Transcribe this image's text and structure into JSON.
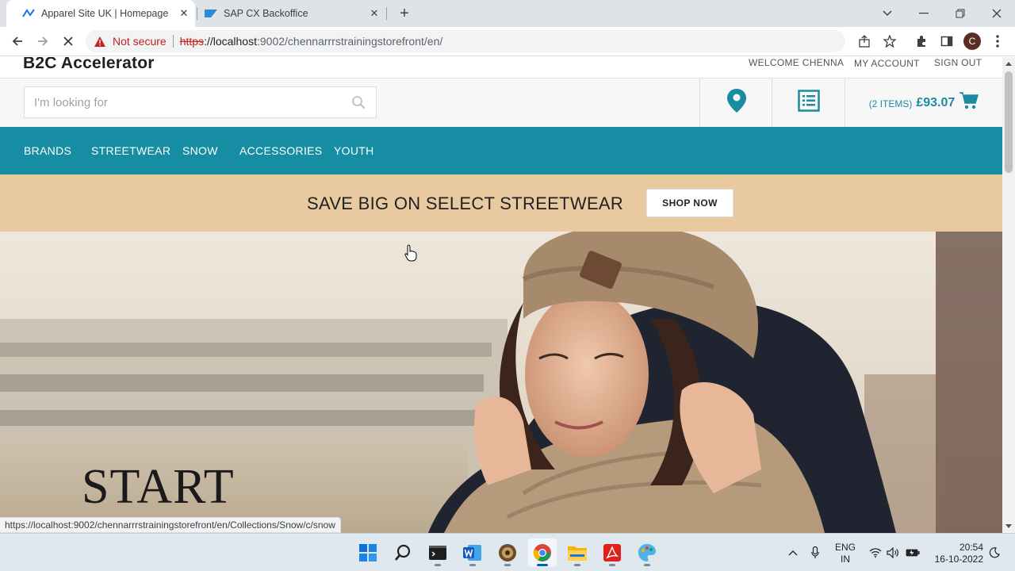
{
  "browser": {
    "tabs": [
      {
        "title": "Apparel Site UK | Homepage",
        "active": true
      },
      {
        "title": "SAP CX Backoffice",
        "active": false
      }
    ],
    "security_label": "Not secure",
    "url_scheme": "https",
    "url_host": "://localhost",
    "url_rest": ":9002/chennarrrstrainingstorefront/en/",
    "profile_initial": "C",
    "status_url": "https://localhost:9002/chennarrrstrainingstorefront/en/Collections/Snow/c/snow"
  },
  "site": {
    "logo": "B2C Accelerator",
    "top_links": [
      "WELCOME CHENNA",
      "MY ACCOUNT",
      "SIGN OUT"
    ],
    "search_placeholder": "I'm looking for",
    "cart": {
      "count_label": "(2 ITEMS)",
      "total": "£93.07"
    },
    "nav": [
      "BRANDS",
      "STREETWEAR",
      "SNOW",
      "ACCESSORIES",
      "YOUTH"
    ],
    "promo": {
      "text": "SAVE BIG ON SELECT STREETWEAR",
      "button": "SHOP NOW"
    },
    "hero": {
      "title": "START"
    }
  },
  "taskbar": {
    "language": {
      "line1": "ENG",
      "line2": "IN"
    },
    "time": "20:54",
    "date": "16-10-2022"
  },
  "colors": {
    "nav_bg": "#168da3",
    "promo_bg": "#e8c9a0",
    "accent": "#1b8ba2"
  }
}
